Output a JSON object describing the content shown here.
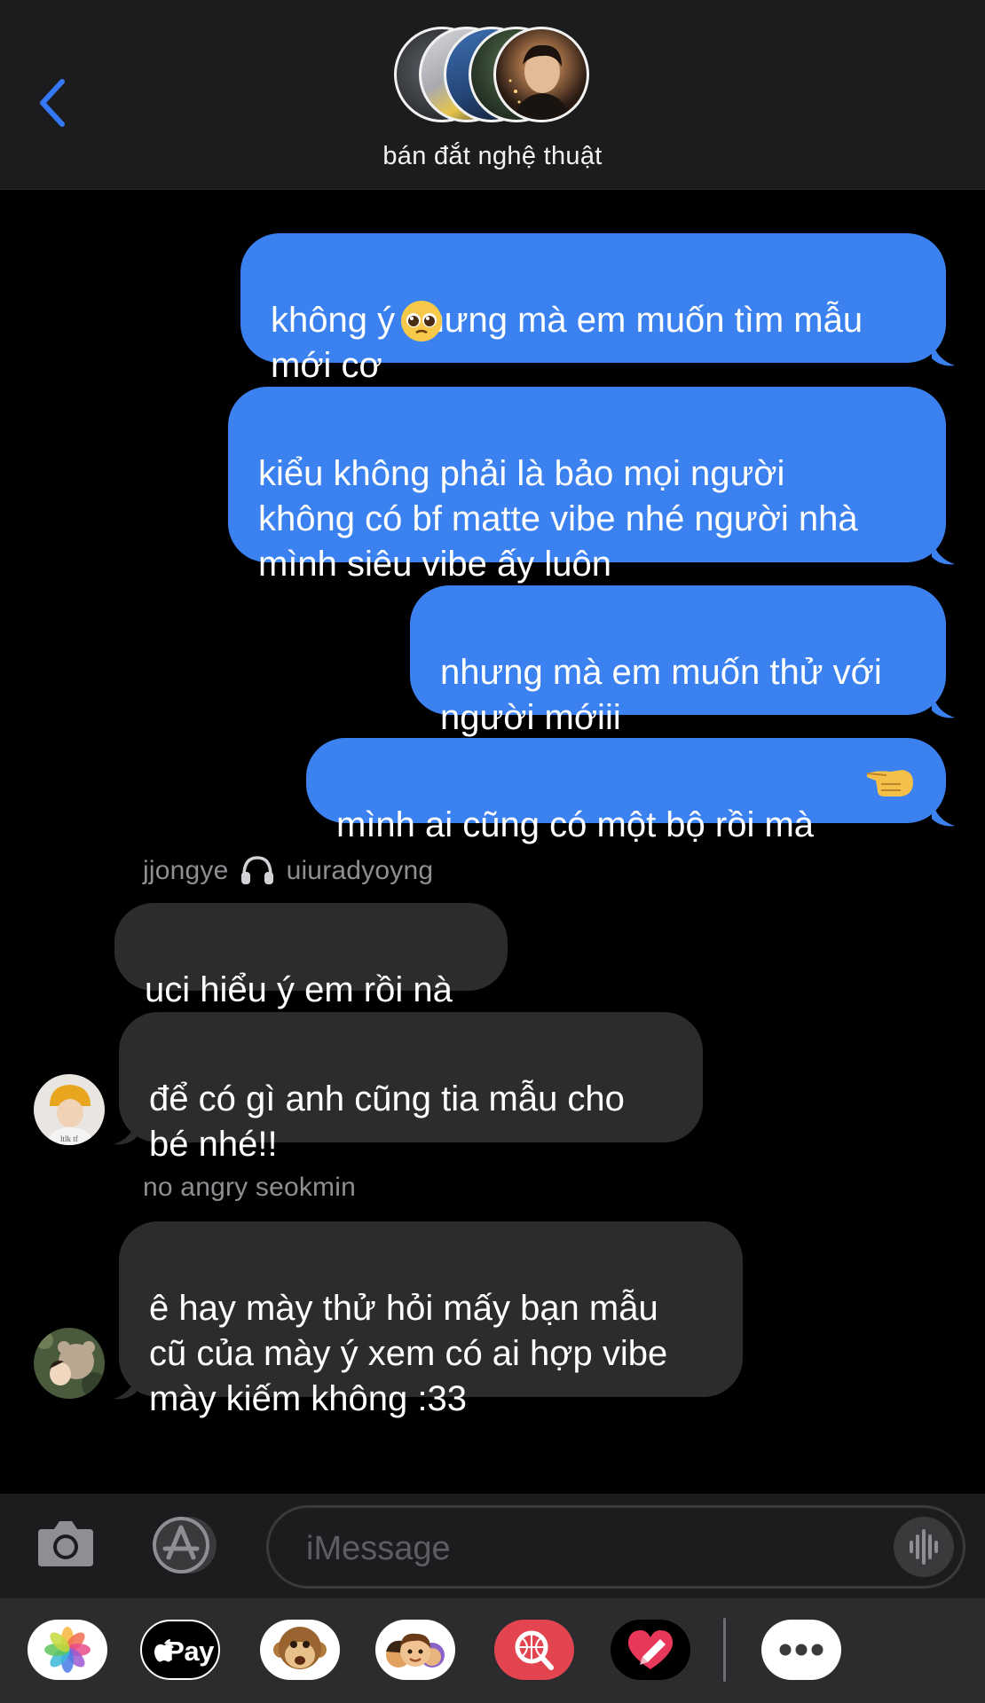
{
  "header": {
    "back_icon": "chevron-left-icon",
    "group_name": "bán đắt nghệ thuật"
  },
  "messages": [
    {
      "side": "sent",
      "text": "không ý nhưng mà em muốn tìm mẫu\nmới cơ",
      "emoji": "pleading-face-emoji"
    },
    {
      "side": "sent",
      "text": "kiểu không phải là bảo mọi người\nkhông có bf matte vibe nhé người nhà\nmình siêu vibe ấy luôn"
    },
    {
      "side": "sent",
      "text": "nhưng mà em muốn thử với\nngười mớiii"
    },
    {
      "side": "sent",
      "text": "mình ai cũng có một bộ rồi mà",
      "emoji": "backhand-pointing-left-emoji"
    },
    {
      "side": "received",
      "sender": "jjongye",
      "sender_suffix": "uiuradyoyng",
      "sender_icon": "headphones-icon",
      "text": "uci hiểu ý em rồi nà"
    },
    {
      "side": "received",
      "text": "để có gì anh cũng tia mẫu cho\nbé nhé!!",
      "avatar": "yellow-hat-avatar"
    },
    {
      "side": "received",
      "sender": "no angry seokmin",
      "text": "ê hay mày thử hỏi mấy bạn mẫu\ncũ của mày ý xem có ai hợp vibe\nmày kiếm không :33",
      "avatar": "teddy-bear-avatar"
    }
  ],
  "input": {
    "placeholder": "iMessage",
    "camera_icon": "camera-icon",
    "apps_icon": "app-store-icon",
    "audio_icon": "waveform-icon"
  },
  "tray": {
    "items": [
      "photos-icon",
      "apple-pay-icon",
      "animoji-monkey-icon",
      "memoji-icon",
      "image-search-icon",
      "digital-touch-icon",
      "more-icon"
    ],
    "apple_pay_label": "Pay"
  },
  "colors": {
    "sent_bubble": "#3b82f0",
    "received_bubble": "#2c2c2e",
    "accent": "#3478f6"
  }
}
